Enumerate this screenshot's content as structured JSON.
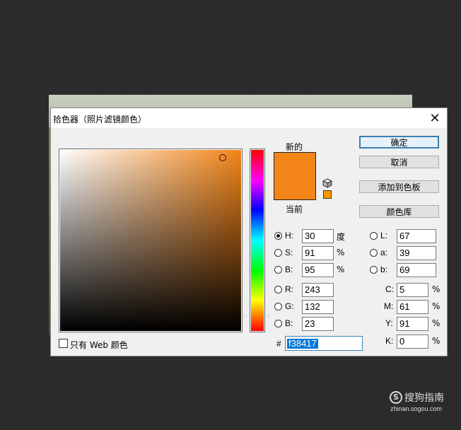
{
  "dialog": {
    "title": "拾色器（照片滤镜颜色）",
    "close_glyph": "✕"
  },
  "swatches": {
    "new_label": "新的",
    "current_label": "当前",
    "new_color": "#f38417",
    "websafe_color": "#ff9900"
  },
  "buttons": {
    "ok": "确定",
    "cancel": "取消",
    "add_to_swatches": "添加到色板",
    "color_libraries": "颜色库"
  },
  "hsb": {
    "h_label": "H:",
    "h_value": "30",
    "h_unit": "度",
    "s_label": "S:",
    "s_value": "91",
    "s_unit": "%",
    "b_label": "B:",
    "b_value": "95",
    "b_unit": "%"
  },
  "rgb": {
    "r_label": "R:",
    "r_value": "243",
    "g_label": "G:",
    "g_value": "132",
    "b_label": "B:",
    "b_value": "23"
  },
  "lab": {
    "l_label": "L:",
    "l_value": "67",
    "a_label": "a:",
    "a_value": "39",
    "b_label": "b:",
    "b_value": "69"
  },
  "cmyk": {
    "c_label": "C:",
    "c_value": "5",
    "c_unit": "%",
    "m_label": "M:",
    "m_value": "61",
    "m_unit": "%",
    "y_label": "Y:",
    "y_value": "91",
    "y_unit": "%",
    "k_label": "K:",
    "k_value": "0",
    "k_unit": "%"
  },
  "hex": {
    "label": "#",
    "value": "f38417"
  },
  "web_only": {
    "label": "只有 Web 颜色",
    "checked": false
  },
  "watermark": {
    "logo": "S",
    "name": "搜狗指南",
    "url": "zhinan.sogou.com"
  }
}
